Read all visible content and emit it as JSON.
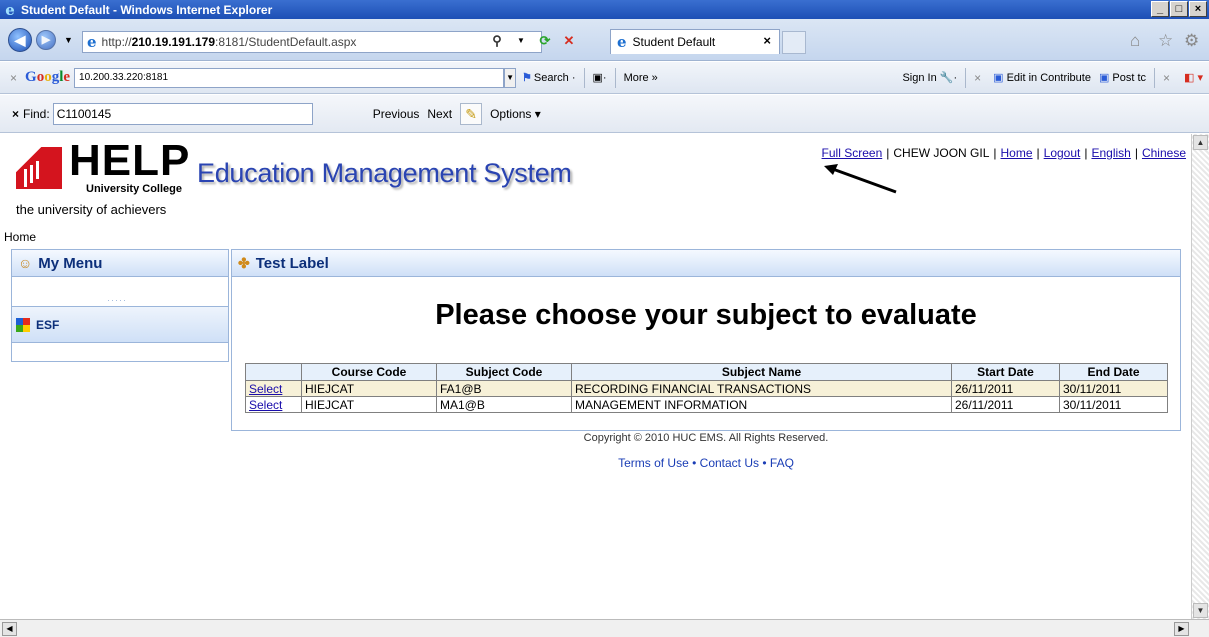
{
  "window": {
    "title": "Student Default - Windows Internet Explorer",
    "minimize": "_",
    "maximize": "□",
    "close": "×"
  },
  "address": {
    "url_prefix": "http://",
    "url_host": "210.19.191.179",
    "url_rest": ":8181/StudentDefault.aspx",
    "tab_title": "Student Default"
  },
  "google_toolbar": {
    "search_value": "10.200.33.220:8181",
    "search_label": "Search",
    "more_label": "More",
    "sign_in_label": "Sign In",
    "edit_contribute_label": "Edit in Contribute",
    "post_label": "Post tc"
  },
  "find_bar": {
    "label": "Find:",
    "value": "C1100145",
    "previous_label": "Previous",
    "next_label": "Next",
    "options_label": "Options"
  },
  "header": {
    "logo_text": "HELP",
    "logo_subtitle": "University College",
    "tagline": "the university of achievers",
    "system_title": "Education Management System",
    "links": {
      "full_screen": "Full Screen",
      "user_name": "CHEW JOON GIL",
      "home": "Home",
      "logout": "Logout",
      "english": "English",
      "chinese": "Chinese"
    }
  },
  "breadcrumb": "Home",
  "menu": {
    "title": "My Menu",
    "items": [
      {
        "label": "ESF"
      }
    ]
  },
  "main": {
    "panel_title": "Test Label",
    "heading": "Please choose your subject to evaluate",
    "table": {
      "columns": [
        "",
        "Course Code",
        "Subject Code",
        "Subject Name",
        "Start Date",
        "End Date"
      ],
      "rows": [
        {
          "action": "Select",
          "course_code": "HIEJCAT",
          "subject_code": "FA1@B",
          "subject_name": "RECORDING FINANCIAL TRANSACTIONS",
          "start_date": "26/11/2011",
          "end_date": "30/11/2011"
        },
        {
          "action": "Select",
          "course_code": "HIEJCAT",
          "subject_code": "MA1@B",
          "subject_name": "MANAGEMENT INFORMATION",
          "start_date": "26/11/2011",
          "end_date": "30/11/2011"
        }
      ]
    }
  },
  "footer": {
    "copyright": "Copyright © 2010 HUC EMS. All Rights Reserved.",
    "terms": "Terms of Use",
    "contact": "Contact Us",
    "faq": "FAQ",
    "separator": "•"
  }
}
